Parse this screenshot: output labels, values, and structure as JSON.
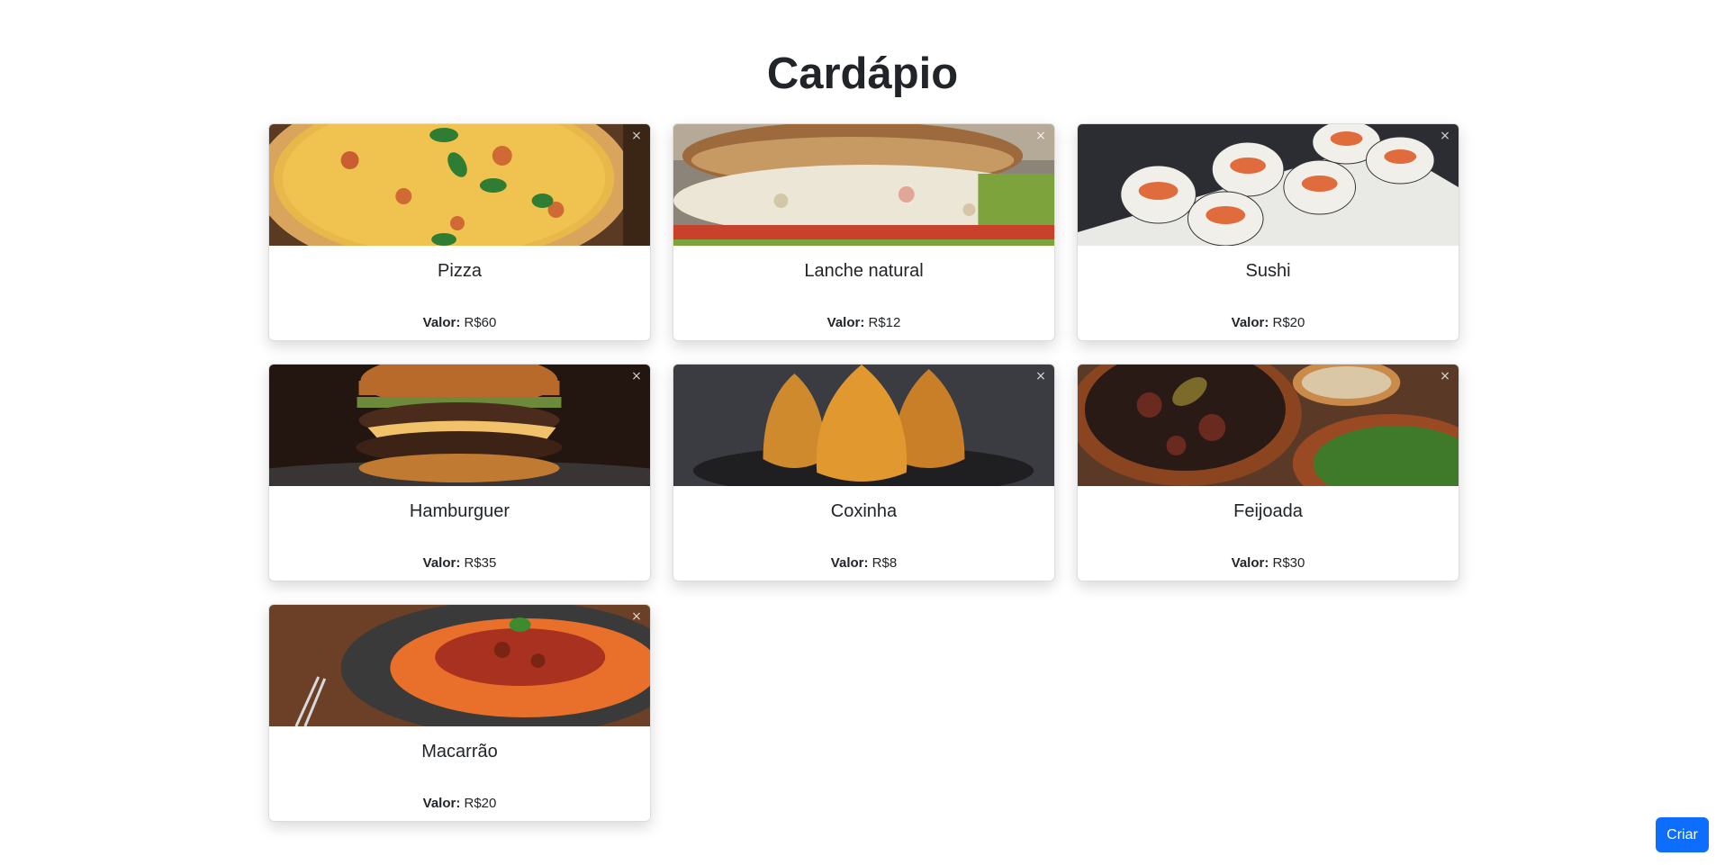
{
  "page": {
    "title": "Cardápio"
  },
  "price_label": "Valor:",
  "close_glyph": "×",
  "items": [
    {
      "name": "Pizza",
      "price": "R$60",
      "image": "pizza-photo"
    },
    {
      "name": "Lanche natural",
      "price": "R$12",
      "image": "sandwich-photo"
    },
    {
      "name": "Sushi",
      "price": "R$20",
      "image": "sushi-photo"
    },
    {
      "name": "Hamburguer",
      "price": "R$35",
      "image": "burger-photo"
    },
    {
      "name": "Coxinha",
      "price": "R$8",
      "image": "coxinha-photo"
    },
    {
      "name": "Feijoada",
      "price": "R$30",
      "image": "feijoada-photo"
    },
    {
      "name": "Macarrão",
      "price": "R$20",
      "image": "spaghetti-photo"
    }
  ],
  "actions": {
    "create_label": "Criar"
  },
  "colors": {
    "primary": "#0d6efd",
    "text": "#212529"
  }
}
